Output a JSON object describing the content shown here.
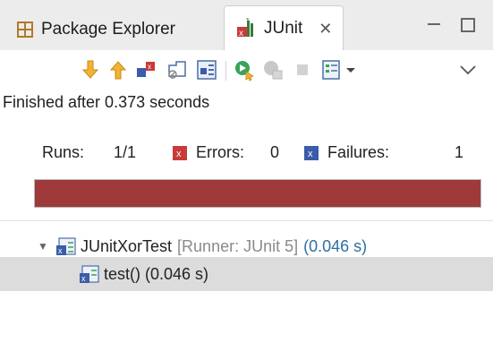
{
  "tabs": {
    "package_explorer": "Package Explorer",
    "junit": "JUnit",
    "close_glyph": "✕"
  },
  "toolbar": {
    "icons": [
      "next-failure-icon",
      "previous-failure-icon",
      "show-failures-only-icon",
      "scroll-lock-icon",
      "show-skipped-icon",
      "rerun-icon",
      "rerun-failed-first-icon",
      "stop-icon",
      "history-icon",
      "view-menu-icon"
    ]
  },
  "status": {
    "text": "Finished after 0.373 seconds"
  },
  "counters": {
    "runs_label": "Runs:",
    "runs_value": "1/1",
    "errors_label": "Errors:",
    "errors_value": "0",
    "failures_label": "Failures:",
    "failures_value": "1"
  },
  "progress": {
    "fraction": 1.0,
    "color": "#9e3a3a"
  },
  "tree": {
    "class_name": "JUnitXorTest",
    "runner": "[Runner: JUnit 5]",
    "class_time": "(0.046 s)",
    "test_label": "test() (0.046 s)"
  },
  "colors": {
    "failure_red": "#9e3a3a",
    "time_blue": "#2f6f9f"
  }
}
